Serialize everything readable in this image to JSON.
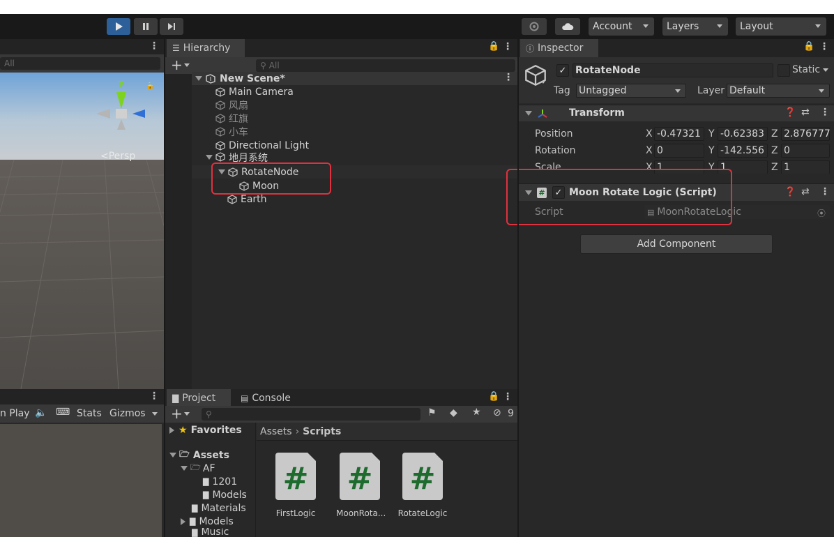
{
  "toolbar": {
    "account_label": "Account",
    "layers_label": "Layers",
    "layout_label": "Layout",
    "play_icon": "play-icon",
    "pause_icon": "pause-icon",
    "step_icon": "step-icon"
  },
  "scene": {
    "search_placeholder": "All",
    "persp_label": "<Persp",
    "gizmo_y": "y"
  },
  "game": {
    "play_label": "n Play",
    "stats_label": "Stats",
    "gizmos_label": "Gizmos"
  },
  "hierarchy": {
    "tab_label": "Hierarchy",
    "search_placeholder": "All",
    "scene_name": "New Scene*",
    "items": [
      {
        "label": "Main Camera"
      },
      {
        "label": "风扇"
      },
      {
        "label": "红旗"
      },
      {
        "label": "小车"
      },
      {
        "label": "Directional Light"
      },
      {
        "label": "地月系统"
      },
      {
        "label": "RotateNode"
      },
      {
        "label": "Moon"
      },
      {
        "label": "Earth"
      }
    ]
  },
  "project": {
    "tab_project": "Project",
    "tab_console": "Console",
    "hidden_count": "9",
    "favorites_label": "Favorites",
    "assets_label": "Assets",
    "tree": [
      "AF",
      "1201",
      "Models",
      "Materials",
      "Models",
      "Music"
    ],
    "breadcrumb": [
      "Assets",
      "Scripts"
    ],
    "files": [
      {
        "name": "FirstLogic"
      },
      {
        "name": "MoonRota..."
      },
      {
        "name": "RotateLogic"
      }
    ]
  },
  "inspector": {
    "tab_label": "Inspector",
    "object_name": "RotateNode",
    "static_label": "Static",
    "tag_label": "Tag",
    "tag_value": "Untagged",
    "layer_label": "Layer",
    "layer_value": "Default",
    "transform": {
      "title": "Transform",
      "position_label": "Position",
      "rotation_label": "Rotation",
      "scale_label": "Scale",
      "position": {
        "x": "-0.47321",
        "y": "-0.62383",
        "z": "2.876777"
      },
      "rotation": {
        "x": "0",
        "y": "-142.556",
        "z": "0"
      },
      "scale": {
        "x": "1",
        "y": "1",
        "z": "1"
      },
      "axis_x": "X",
      "axis_y": "Y",
      "axis_z": "Z"
    },
    "script_component": {
      "title": "Moon Rotate Logic (Script)",
      "script_label": "Script",
      "script_value": "MoonRotateLogic"
    },
    "add_component_label": "Add Component"
  },
  "colors": {
    "highlight_box": "#e0313f",
    "play_active": "#2d5f99"
  }
}
